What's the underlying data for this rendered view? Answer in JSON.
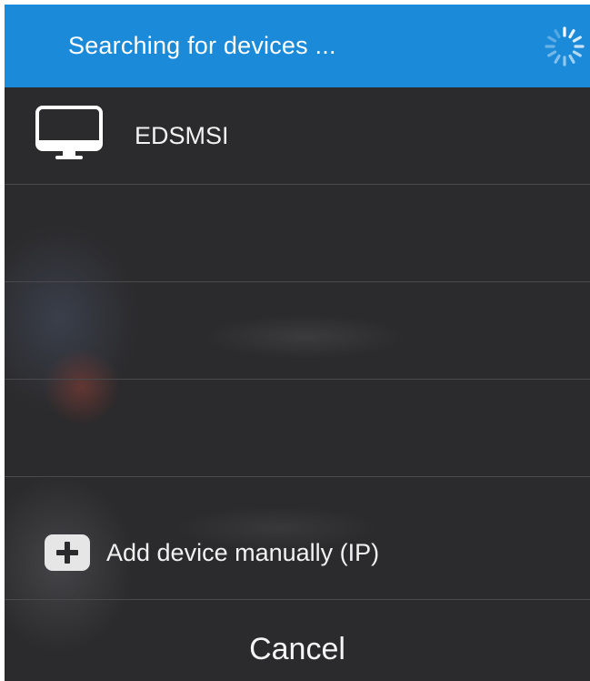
{
  "header": {
    "title": "Searching for devices ...",
    "spinner_icon": "loading-spinner-icon",
    "background_color": "#1a8ad9"
  },
  "devices": [
    {
      "name": "EDSMSI",
      "icon": "desktop-monitor-icon"
    }
  ],
  "add_device": {
    "label": "Add device manually (IP)",
    "icon": "plus-icon"
  },
  "cancel_label": "Cancel",
  "colors": {
    "panel": "#2b2a2c",
    "separator": "#4a494b",
    "text": "#f2f2f2"
  }
}
